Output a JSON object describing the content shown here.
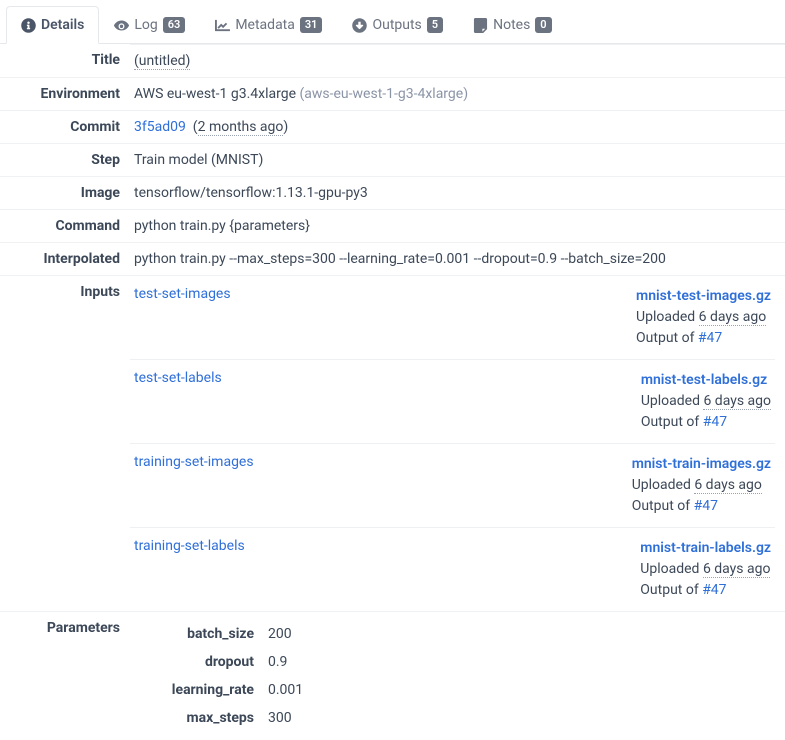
{
  "tabs": {
    "details": "Details",
    "log": "Log",
    "log_count": "63",
    "metadata": "Metadata",
    "metadata_count": "31",
    "outputs": "Outputs",
    "outputs_count": "5",
    "notes": "Notes",
    "notes_count": "0"
  },
  "rows": {
    "title_label": "Title",
    "title_value": "(untitled)",
    "env_label": "Environment",
    "env_name": "AWS eu-west-1 g3.4xlarge",
    "env_slug": "(aws-eu-west-1-g3-4xlarge)",
    "commit_label": "Commit",
    "commit_hash": "3f5ad09",
    "commit_age": "2 months ago",
    "step_label": "Step",
    "step_value": "Train model (MNIST)",
    "image_label": "Image",
    "image_value": "tensorflow/tensorflow:1.13.1-gpu-py3",
    "command_label": "Command",
    "command_value": "python train.py {parameters}",
    "interpolated_label": "Interpolated",
    "interpolated_value": "python train.py --max_steps=300 --learning_rate=0.001 --dropout=0.9 --batch_size=200",
    "inputs_label": "Inputs",
    "parameters_label": "Parameters"
  },
  "inputs": [
    {
      "name": "test-set-images",
      "file": "mnist-test-images.gz",
      "uploaded_prefix": "Uploaded ",
      "uploaded_age": "6 days ago",
      "output_prefix": "Output of ",
      "output_ref": "#47"
    },
    {
      "name": "test-set-labels",
      "file": "mnist-test-labels.gz",
      "uploaded_prefix": "Uploaded ",
      "uploaded_age": "6 days ago",
      "output_prefix": "Output of ",
      "output_ref": "#47"
    },
    {
      "name": "training-set-images",
      "file": "mnist-train-images.gz",
      "uploaded_prefix": "Uploaded ",
      "uploaded_age": "6 days ago",
      "output_prefix": "Output of ",
      "output_ref": "#47"
    },
    {
      "name": "training-set-labels",
      "file": "mnist-train-labels.gz",
      "uploaded_prefix": "Uploaded ",
      "uploaded_age": "6 days ago",
      "output_prefix": "Output of ",
      "output_ref": "#47"
    }
  ],
  "parameters": [
    {
      "key": "batch_size",
      "value": "200"
    },
    {
      "key": "dropout",
      "value": "0.9"
    },
    {
      "key": "learning_rate",
      "value": "0.001"
    },
    {
      "key": "max_steps",
      "value": "300"
    }
  ]
}
